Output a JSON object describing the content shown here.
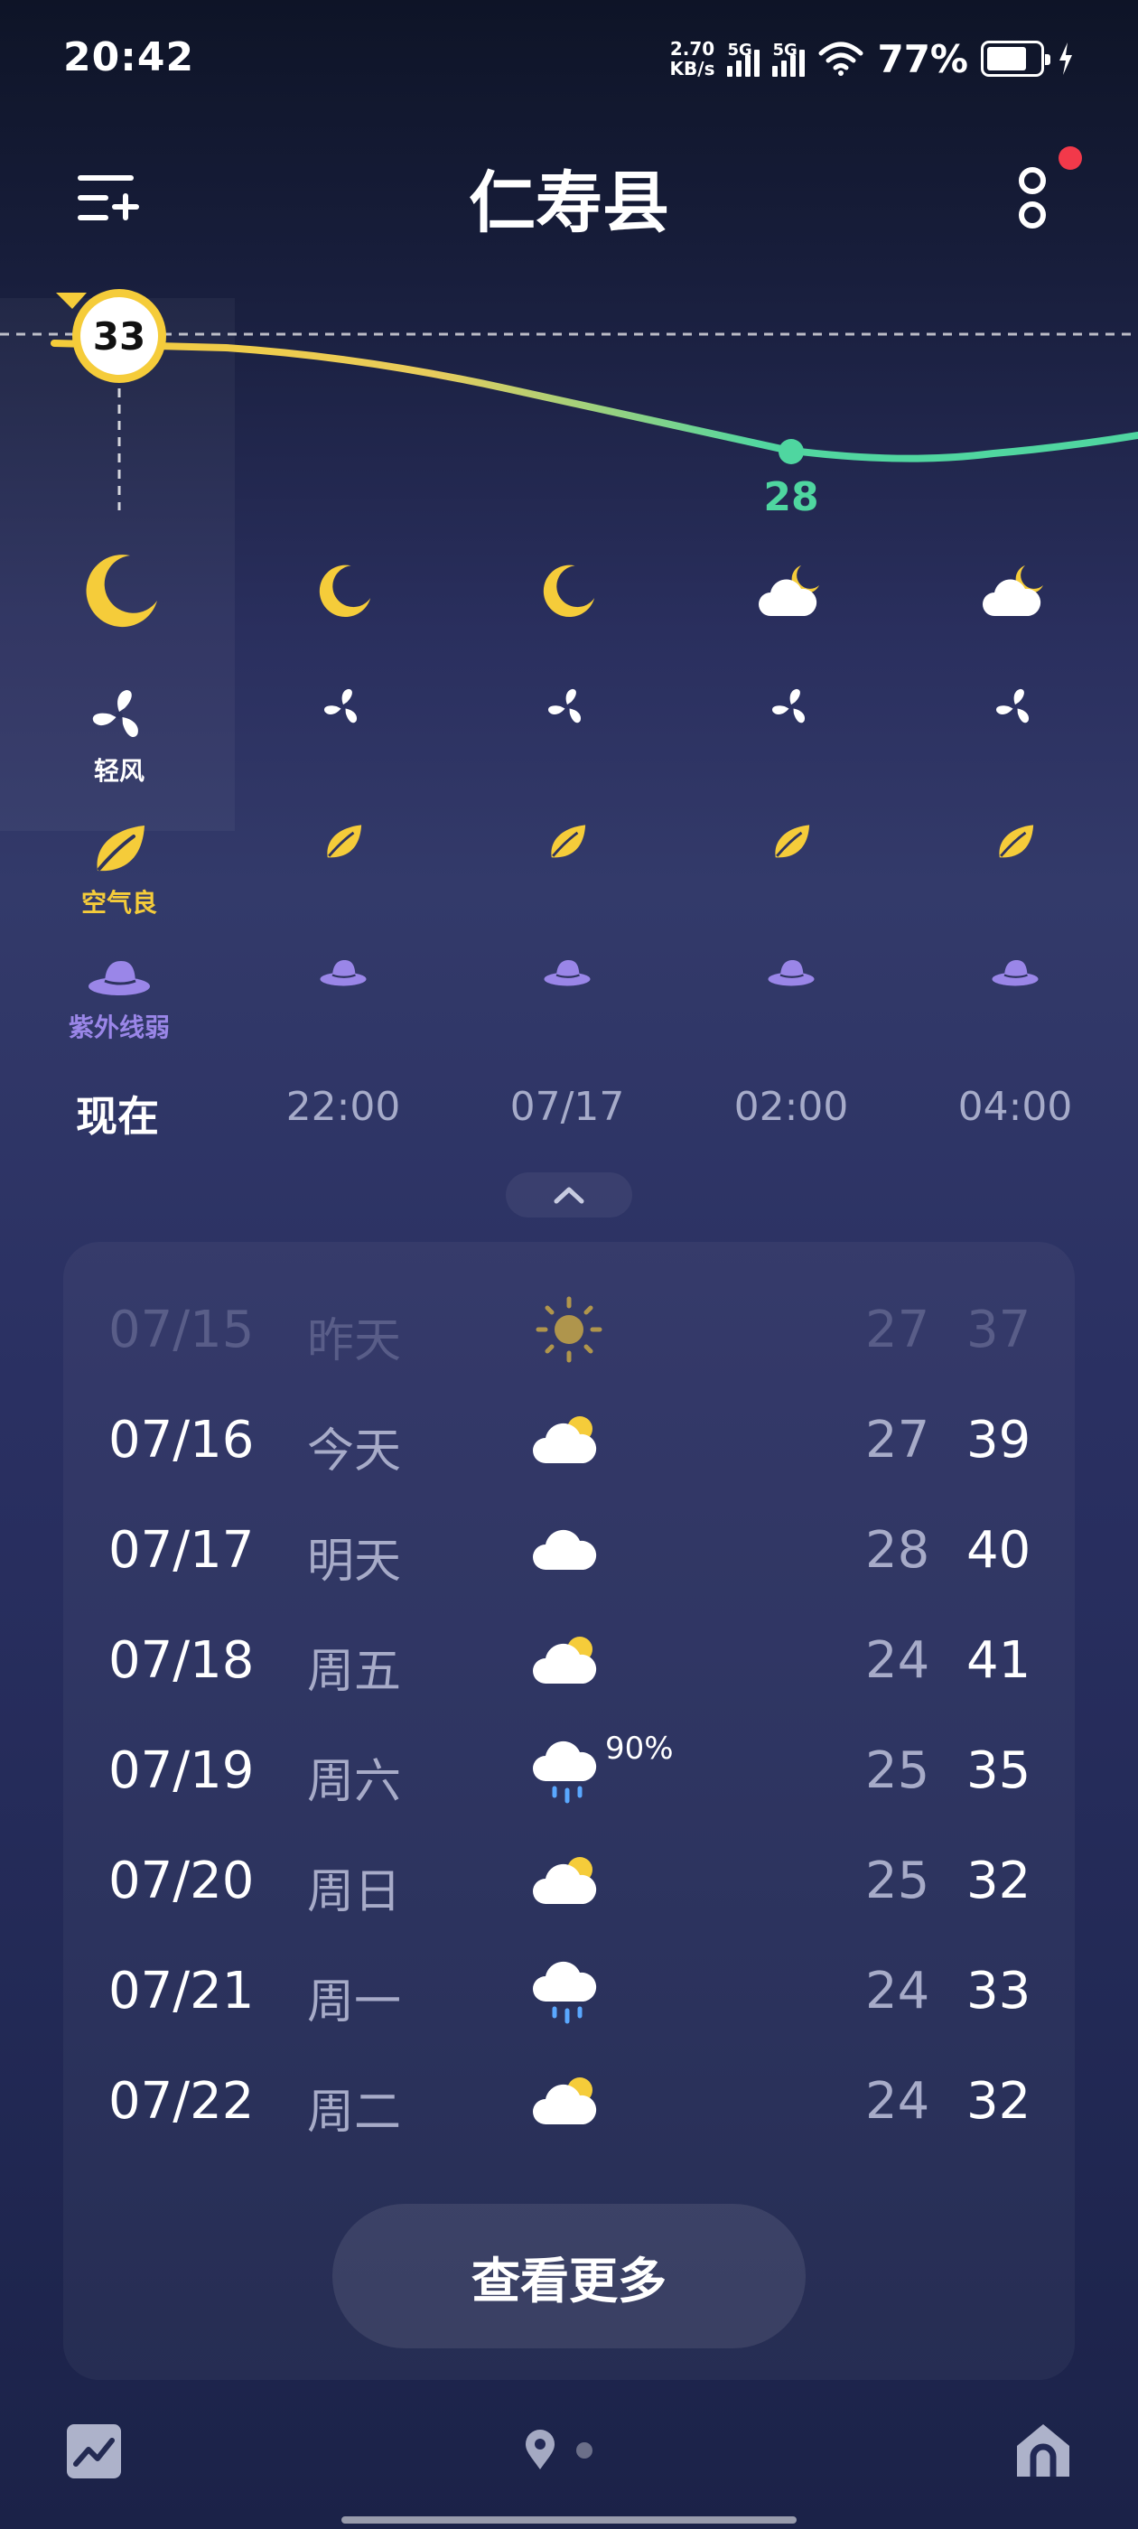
{
  "status_bar": {
    "time": "20:42",
    "net_speed_value": "2.70",
    "net_speed_unit": "KB/s",
    "sim1_label": "5G",
    "sim2_label": "5G",
    "battery": "77%"
  },
  "header": {
    "title": "仁寿县"
  },
  "hourly": {
    "current_temp": "33",
    "min_temp_label": "28",
    "columns": [
      {
        "time": "现在",
        "icon": "moon-icon",
        "wind": "轻风",
        "aqi": "空气良",
        "uv": "紫外线弱"
      },
      {
        "time": "22:00",
        "icon": "moon-icon"
      },
      {
        "time": "07/17",
        "icon": "moon-icon"
      },
      {
        "time": "02:00",
        "icon": "cloudy-night-icon"
      },
      {
        "time": "04:00",
        "icon": "cloudy-night-icon"
      }
    ]
  },
  "daily": [
    {
      "date": "07/15",
      "day": "昨天",
      "icon": "sun-icon",
      "low": "27",
      "high": "37",
      "past": true
    },
    {
      "date": "07/16",
      "day": "今天",
      "icon": "partly-cloudy-icon",
      "low": "27",
      "high": "39"
    },
    {
      "date": "07/17",
      "day": "明天",
      "icon": "cloud-icon",
      "low": "28",
      "high": "40"
    },
    {
      "date": "07/18",
      "day": "周五",
      "icon": "partly-cloudy-icon",
      "low": "24",
      "high": "41"
    },
    {
      "date": "07/19",
      "day": "周六",
      "icon": "rain-icon",
      "precip": "90%",
      "low": "25",
      "high": "35"
    },
    {
      "date": "07/20",
      "day": "周日",
      "icon": "partly-cloudy-icon",
      "low": "25",
      "high": "32"
    },
    {
      "date": "07/21",
      "day": "周一",
      "icon": "rain-icon",
      "low": "24",
      "high": "33"
    },
    {
      "date": "07/22",
      "day": "周二",
      "icon": "partly-cloudy-icon",
      "low": "24",
      "high": "32"
    }
  ],
  "more_button": "查看更多",
  "colors": {
    "accent_yellow": "#f5cc3a",
    "accent_green": "#4fd6a0",
    "uv_purple": "#9a86e8",
    "notification_red": "#f2394a"
  }
}
